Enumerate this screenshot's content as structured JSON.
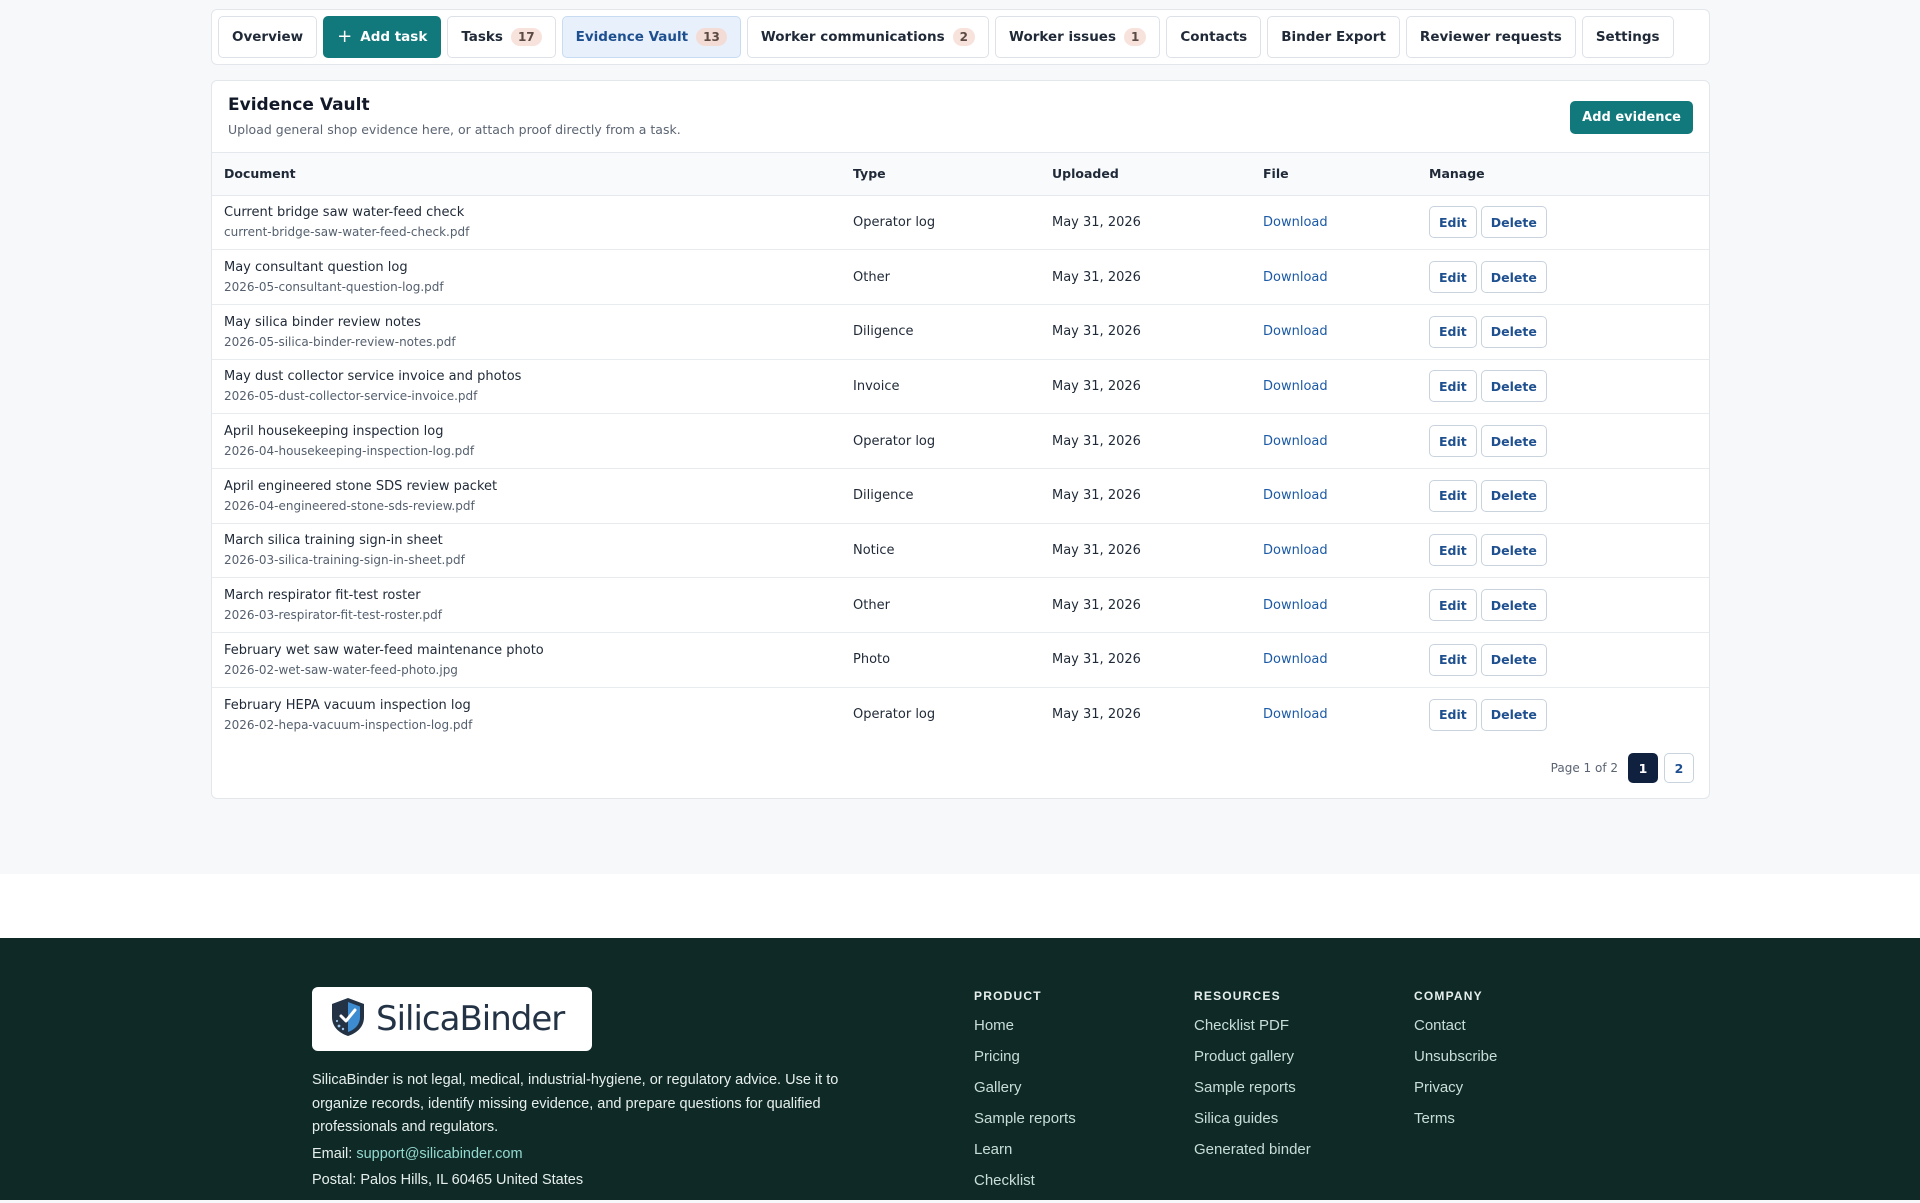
{
  "tabs": [
    {
      "label": "Overview",
      "count": null,
      "style": "default"
    },
    {
      "label": "Add task",
      "count": null,
      "style": "primary"
    },
    {
      "label": "Tasks",
      "count": "17",
      "style": "default"
    },
    {
      "label": "Evidence Vault",
      "count": "13",
      "style": "active"
    },
    {
      "label": "Worker communications",
      "count": "2",
      "style": "default"
    },
    {
      "label": "Worker issues",
      "count": "1",
      "style": "default"
    },
    {
      "label": "Contacts",
      "count": null,
      "style": "default"
    },
    {
      "label": "Binder Export",
      "count": null,
      "style": "default"
    },
    {
      "label": "Reviewer requests",
      "count": null,
      "style": "default"
    },
    {
      "label": "Settings",
      "count": null,
      "style": "default"
    }
  ],
  "vault": {
    "title": "Evidence Vault",
    "subtitle": "Upload general shop evidence here, or attach proof directly from a task.",
    "add_button": "Add evidence",
    "columns": {
      "document": "Document",
      "type": "Type",
      "uploaded": "Uploaded",
      "file": "File",
      "manage": "Manage"
    },
    "rows": [
      {
        "title": "Current bridge saw water-feed check",
        "file": "current-bridge-saw-water-feed-check.pdf",
        "type": "Operator log",
        "uploaded": "May 31, 2026"
      },
      {
        "title": "May consultant question log",
        "file": "2026-05-consultant-question-log.pdf",
        "type": "Other",
        "uploaded": "May 31, 2026"
      },
      {
        "title": "May silica binder review notes",
        "file": "2026-05-silica-binder-review-notes.pdf",
        "type": "Diligence",
        "uploaded": "May 31, 2026"
      },
      {
        "title": "May dust collector service invoice and photos",
        "file": "2026-05-dust-collector-service-invoice.pdf",
        "type": "Invoice",
        "uploaded": "May 31, 2026"
      },
      {
        "title": "April housekeeping inspection log",
        "file": "2026-04-housekeeping-inspection-log.pdf",
        "type": "Operator log",
        "uploaded": "May 31, 2026"
      },
      {
        "title": "April engineered stone SDS review packet",
        "file": "2026-04-engineered-stone-sds-review.pdf",
        "type": "Diligence",
        "uploaded": "May 31, 2026"
      },
      {
        "title": "March silica training sign-in sheet",
        "file": "2026-03-silica-training-sign-in-sheet.pdf",
        "type": "Notice",
        "uploaded": "May 31, 2026"
      },
      {
        "title": "March respirator fit-test roster",
        "file": "2026-03-respirator-fit-test-roster.pdf",
        "type": "Other",
        "uploaded": "May 31, 2026"
      },
      {
        "title": "February wet saw water-feed maintenance photo",
        "file": "2026-02-wet-saw-water-feed-photo.jpg",
        "type": "Photo",
        "uploaded": "May 31, 2026"
      },
      {
        "title": "February HEPA vacuum inspection log",
        "file": "2026-02-hepa-vacuum-inspection-log.pdf",
        "type": "Operator log",
        "uploaded": "May 31, 2026"
      }
    ],
    "row_actions": {
      "download": "Download",
      "edit": "Edit",
      "delete": "Delete"
    },
    "pagination": {
      "text": "Page 1 of 2",
      "pages": [
        "1",
        "2"
      ],
      "current": "1"
    }
  },
  "footer": {
    "logo_text": "SilicaBinder",
    "disclaimer": "SilicaBinder is not legal, medical, industrial-hygiene, or regulatory advice. Use it to organize records, identify missing evidence, and prepare questions for qualified professionals and regulators.",
    "email_label": "Email:",
    "email": "support@silicabinder.com",
    "postal": "Postal: Palos Hills, IL 60465 United States",
    "columns": [
      {
        "heading": "PRODUCT",
        "links": [
          "Home",
          "Pricing",
          "Gallery",
          "Sample reports",
          "Learn",
          "Checklist"
        ]
      },
      {
        "heading": "RESOURCES",
        "links": [
          "Checklist PDF",
          "Product gallery",
          "Sample reports",
          "Silica guides",
          "Generated binder"
        ]
      },
      {
        "heading": "COMPANY",
        "links": [
          "Contact",
          "Unsubscribe",
          "Privacy",
          "Terms"
        ]
      }
    ]
  },
  "colors": {
    "brand": "#11797c",
    "footer_bg": "#0f2a26",
    "link": "#1c5aa6",
    "current_page": "#10213f"
  },
  "icons": {
    "add_task": "plus-icon",
    "logo": "shield-logo-icon"
  }
}
